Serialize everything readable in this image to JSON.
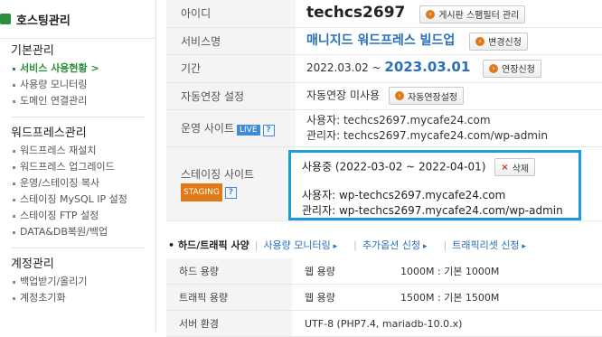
{
  "sidebar": {
    "header": "호스팅관리",
    "sections": [
      {
        "title": "기본관리",
        "items": [
          {
            "label": "서비스 사용현황 >",
            "active": true
          },
          {
            "label": "사용량 모니터링",
            "active": false
          },
          {
            "label": "도메인 연결관리",
            "active": false
          }
        ]
      },
      {
        "title": "워드프레스관리",
        "items": [
          {
            "label": "워드프레스 재설치"
          },
          {
            "label": "워드프레스 업그레이드"
          },
          {
            "label": "운영/스테이징 복사"
          },
          {
            "label": "스테이징 MySQL IP 설정"
          },
          {
            "label": "스테이징 FTP 설정"
          },
          {
            "label": "DATA&DB복원/백업"
          }
        ]
      },
      {
        "title": "계정관리",
        "items": [
          {
            "label": "백업받기/올리기"
          },
          {
            "label": "계정초기화"
          }
        ]
      }
    ]
  },
  "info": {
    "id_label": "아이디",
    "id_value": "techcs2697",
    "id_button": "게시판 스팸필터 관리",
    "service_label": "서비스명",
    "service_value": "매니지드 워드프레스 빌드업",
    "service_button": "변경신청",
    "period_label": "기간",
    "period_start": "2022.03.02 ~",
    "period_end": "2023.03.01",
    "period_button": "연장신청",
    "auto_label": "자동연장 설정",
    "auto_value": "자동연장 미사용",
    "auto_button": "자동연장설정",
    "live_label": "운영 사이트",
    "live_badge": "LIVE",
    "live_user": "사용자: techcs2697.mycafe24.com",
    "live_admin": "관리자: techcs2697.mycafe24.com/wp-admin",
    "staging_label": "스테이징 사이트",
    "staging_badge": "STAGING",
    "staging_status": "사용중 (2022-03-02 ~ 2022-04-01)",
    "staging_delete": "삭제",
    "staging_user": "사용자: wp-techcs2697.mycafe24.com",
    "staging_admin": "관리자: wp-techcs2697.mycafe24.com/wp-admin",
    "help_glyph": "?"
  },
  "spec_bar": {
    "title": "하드/트래픽 사양",
    "links": [
      "사용량 모니터링",
      "추가옵션 신청",
      "트래픽리셋 신청"
    ]
  },
  "spec": {
    "rows": [
      {
        "label": "하드 용량",
        "name": "웹 용량",
        "value": "1000M : 기본 1000M"
      },
      {
        "label": "트래픽 용량",
        "name": "웹 용량",
        "value": "1500M : 기본 1500M"
      },
      {
        "label": "서버 환경",
        "name": "UTF-8 (PHP7.4, mariadb-10.0.x)",
        "value": ""
      }
    ]
  },
  "colors": {
    "accent_green": "#2a8f3a",
    "link_blue": "#2a6fb8",
    "highlight_box": "#1d9bd6",
    "badge_orange": "#e07a16"
  }
}
